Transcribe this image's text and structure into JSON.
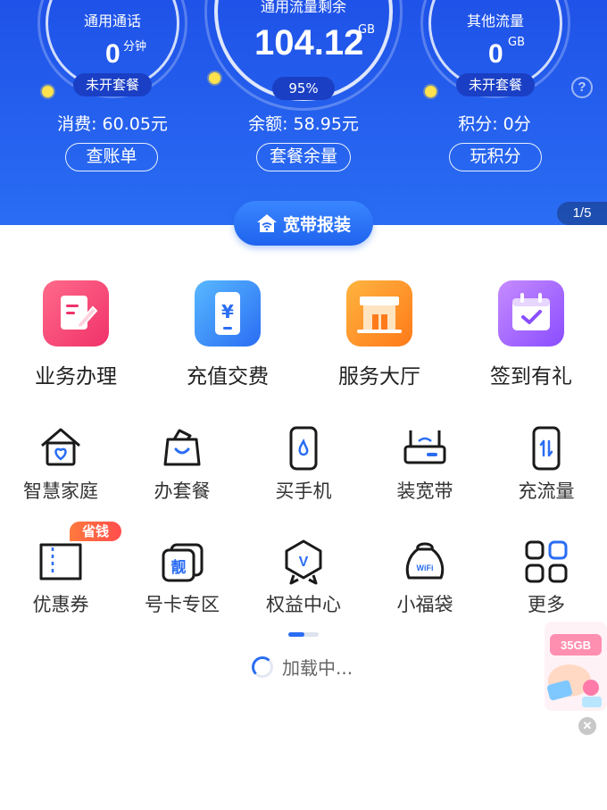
{
  "header": {
    "gauges": [
      {
        "label": "通用通话",
        "value": "0",
        "unit": "分钟",
        "badge": "未开套餐"
      },
      {
        "label": "通用流量剩余",
        "value": "104.12",
        "unit": "GB",
        "badge": "95%"
      },
      {
        "label": "其他流量",
        "value": "0",
        "unit": "GB",
        "badge": "未开套餐"
      }
    ],
    "stats": [
      {
        "text": "消费: 60.05元",
        "button": "查账单"
      },
      {
        "text": "余额: 58.95元",
        "button": "套餐余量"
      },
      {
        "text": "积分: 0分",
        "button": "玩积分"
      }
    ],
    "help": "?",
    "pager": "1/5"
  },
  "broadband": {
    "label": "宽带报装"
  },
  "tiles": [
    {
      "label": "业务办理",
      "icon": "form-edit-icon"
    },
    {
      "label": "充值交费",
      "icon": "phone-yuan-icon"
    },
    {
      "label": "服务大厅",
      "icon": "service-hall-icon"
    },
    {
      "label": "签到有礼",
      "icon": "calendar-check-icon"
    }
  ],
  "grid": [
    {
      "label": "智慧家庭",
      "icon": "smart-home-icon"
    },
    {
      "label": "办套餐",
      "icon": "shopping-bag-icon"
    },
    {
      "label": "买手机",
      "icon": "phone-icon"
    },
    {
      "label": "装宽带",
      "icon": "router-icon"
    },
    {
      "label": "充流量",
      "icon": "data-phone-icon"
    },
    {
      "label": "优惠券",
      "icon": "coupon-icon",
      "badge": "省钱"
    },
    {
      "label": "号卡专区",
      "icon": "sim-card-icon",
      "mark": "靓"
    },
    {
      "label": "权益中心",
      "icon": "rights-badge-icon",
      "mark": "V"
    },
    {
      "label": "小福袋",
      "icon": "lucky-bag-icon",
      "mark": "WiFi"
    },
    {
      "label": "更多",
      "icon": "grid-more-icon"
    }
  ],
  "loading": "加载中...",
  "promo": {
    "text": "35GB"
  },
  "colors": {
    "brand": "#2a6df3",
    "hero_dark": "#1f52e8",
    "knob": "#ffe24d"
  }
}
